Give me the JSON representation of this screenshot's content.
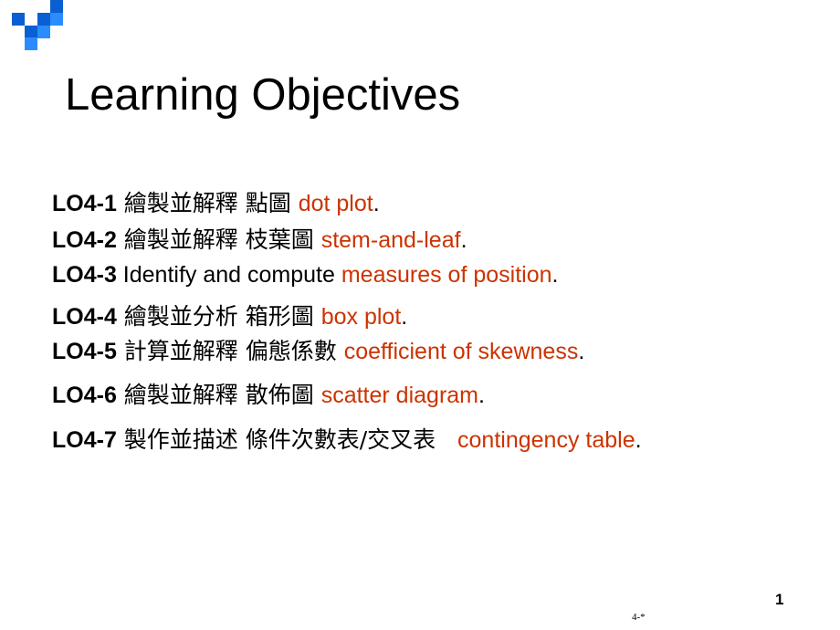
{
  "colors": {
    "accent": "#cc3300",
    "logo_dark": "#0a5fd2",
    "logo_light": "#2a8cff"
  },
  "logo": {
    "icon": "blue-squares-logo-icon"
  },
  "title": "Learning Objectives",
  "objectives": [
    {
      "code": "LO4-1",
      "zh": " 繪製並解釋 點圖 ",
      "en": "dot plot",
      "end": "."
    },
    {
      "code": "LO4-2",
      "zh": " 繪製並解釋 枝葉圖 ",
      "en": "stem-and-leaf",
      "end": "."
    },
    {
      "code": "LO4-3",
      "zh": " Identify and compute ",
      "en": "measures of position",
      "end": "."
    },
    {
      "code": "LO4-4",
      "zh": " 繪製並分析 箱形圖 ",
      "en": "box plot",
      "end": "."
    },
    {
      "code": "LO4-5",
      "zh": " 計算並解釋 偏態係數 ",
      "en": "coefficient of skewness",
      "end": "."
    },
    {
      "code": "LO4-6",
      "zh": " 繪製並解釋 散佈圖 ",
      "en": "scatter diagram",
      "end": "."
    },
    {
      "code": "LO4-7",
      "zh": " 製作並描述 條件次數表/交叉表   ",
      "en": "contingency table",
      "end": "."
    }
  ],
  "slide_number": "1",
  "footer": "4-*"
}
